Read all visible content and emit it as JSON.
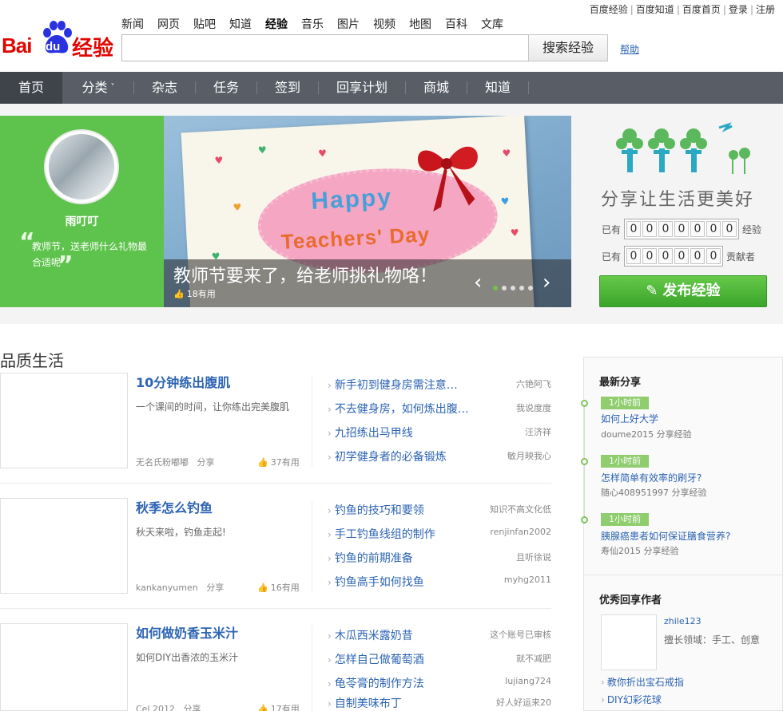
{
  "top_links": [
    "百度经验",
    "百度知道",
    "百度首页",
    "登录",
    "注册"
  ],
  "logo": {
    "bai": "Bai",
    "du": "du",
    "jingyan": "经验"
  },
  "product_nav": [
    "新闻",
    "网页",
    "贴吧",
    "知道",
    "经验",
    "音乐",
    "图片",
    "视频",
    "地图",
    "百科",
    "文库"
  ],
  "search": {
    "value": "",
    "button": "搜索经验",
    "help": "帮助"
  },
  "main_nav": [
    "首页",
    "分类",
    "杂志",
    "任务",
    "签到",
    "回享计划",
    "商城",
    "知道"
  ],
  "user_card": {
    "name": "雨叮叮",
    "text": "教师节，送老师什么礼物最合适呢"
  },
  "banner": {
    "card_line1": "Happy",
    "card_line2": "Teachers' Day",
    "caption": "教师节要来了，给老师挑礼物咯！",
    "useful": "18有用",
    "prev": "‹",
    "next": "›"
  },
  "promo": {
    "slogan": "分享让生活更美好",
    "exp_prefix": "已有",
    "exp_suffix": "经验",
    "exp_digits": [
      "0",
      "0",
      "0",
      "0",
      "0",
      "0",
      "0"
    ],
    "contrib_prefix": "已有",
    "contrib_suffix": "贡献者",
    "contrib_digits": [
      "0",
      "0",
      "0",
      "0",
      "0",
      "0"
    ],
    "publish": "发布经验"
  },
  "section_title": "品质生活",
  "features": [
    {
      "title": "10分钟练出腹肌",
      "desc": "一个课间的时间，让你练出完美腹肌",
      "author": "无名氏粉嘟嘟",
      "action": "分享",
      "useful": "37有用",
      "items": [
        {
          "t": "新手初到健身房需注意…",
          "a": "六铯阿飞"
        },
        {
          "t": "不去健身房，如何炼出腹…",
          "a": "我说度度"
        },
        {
          "t": "九招练出马甲线",
          "a": "汪济祥"
        },
        {
          "t": "初学健身者的必备锻炼",
          "a": "敏月映我心"
        }
      ]
    },
    {
      "title": "秋季怎么钓鱼",
      "desc": "秋天来啦，钓鱼走起!",
      "author": "kankanyumen",
      "action": "分享",
      "useful": "16有用",
      "items": [
        {
          "t": "钓鱼的技巧和要领",
          "a": "知识不高文化低"
        },
        {
          "t": "手工钓鱼线组的制作",
          "a": "renjinfan2002"
        },
        {
          "t": "钓鱼的前期准备",
          "a": "且听徐说"
        },
        {
          "t": "钓鱼高手如何找鱼",
          "a": "myhg2011"
        }
      ]
    },
    {
      "title": "如何做奶香玉米汁",
      "desc": "如何DIY出香浓的玉米汁",
      "author": "Cel 2012",
      "action": "分享",
      "useful": "17有用",
      "items": [
        {
          "t": "木瓜西米露奶昔",
          "a": "这个账号已审核"
        },
        {
          "t": "怎样自己做葡萄酒",
          "a": "就不减肥"
        },
        {
          "t": "龟苓膏的制作方法",
          "a": "lujiang724"
        },
        {
          "t": "自制美味布丁",
          "a": "好人好运来20"
        }
      ]
    }
  ],
  "sidebar": {
    "latest_title": "最新分享",
    "latest": [
      {
        "time": "1小时前",
        "q": "如何上好大学",
        "user": "doume2015",
        "action": "分享经验"
      },
      {
        "time": "1小时前",
        "q": "怎样简单有效率的刷牙?",
        "user": "随心408951997",
        "action": "分享经验"
      },
      {
        "time": "1小时前",
        "q": "胰腺癌患者如何保证膳食营养?",
        "user": "寿仙2015",
        "action": "分享经验"
      }
    ],
    "authors_title": "优秀回享作者",
    "author": {
      "name": "zhile123",
      "field": "擅长领域：手工、创意"
    },
    "author_links": [
      "教你折出宝石戒指",
      "DIY幻彩花球"
    ]
  },
  "colors": {
    "nav_bg": "#585d66",
    "green": "#5ec34c",
    "link": "#2d64b3",
    "brand_red": "#e10601"
  }
}
